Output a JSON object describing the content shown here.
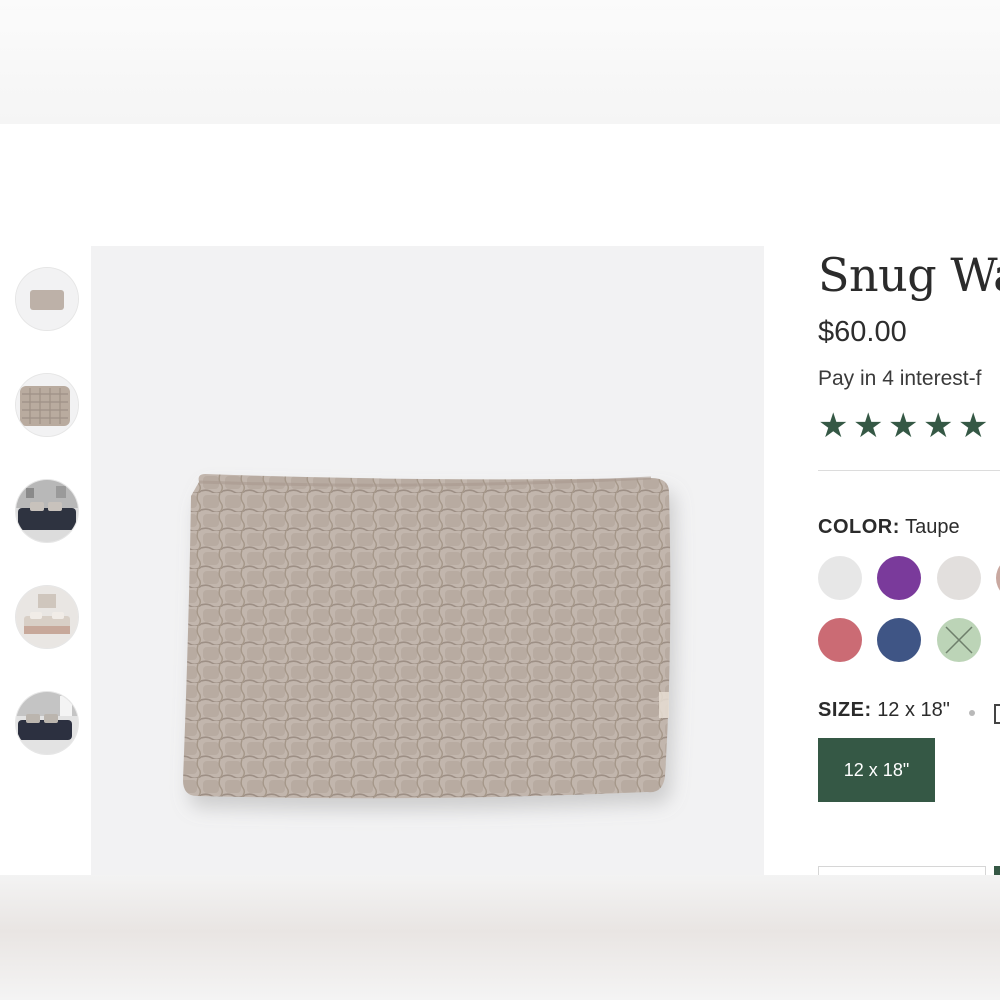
{
  "product": {
    "title": "Snug Wa",
    "price": "$60.00",
    "installments": "Pay in 4 interest-f",
    "rating": {
      "stars": 5,
      "star_glyph": "★",
      "color": "#355845"
    },
    "color": {
      "label": "COLOR:",
      "selected": "Taupe",
      "swatches": [
        {
          "name": "swatch-light-gray",
          "color": "#e7e7e7"
        },
        {
          "name": "swatch-purple",
          "color": "#7a3a9b"
        },
        {
          "name": "swatch-light-taupe",
          "color": "#e2dfdd"
        },
        {
          "name": "swatch-blush-partial",
          "color": "#c9a8a0"
        },
        {
          "name": "swatch-rose",
          "color": "#cb6b74"
        },
        {
          "name": "swatch-navy",
          "color": "#3f5585"
        },
        {
          "name": "swatch-sage-sold-out",
          "color": "#bcd4b7"
        }
      ]
    },
    "size": {
      "label": "SIZE:",
      "selected": "12 x 18\"",
      "options": [
        "12 x 18\""
      ]
    }
  },
  "gallery": {
    "thumbnails": [
      "pillow-front",
      "pillow-closeup",
      "bedroom-dark",
      "bedroom-light",
      "bedroom-dark-2"
    ]
  },
  "colors": {
    "accent": "#355845",
    "image_bg": "#f2f2f3",
    "pillow": "#c1b4ab"
  }
}
